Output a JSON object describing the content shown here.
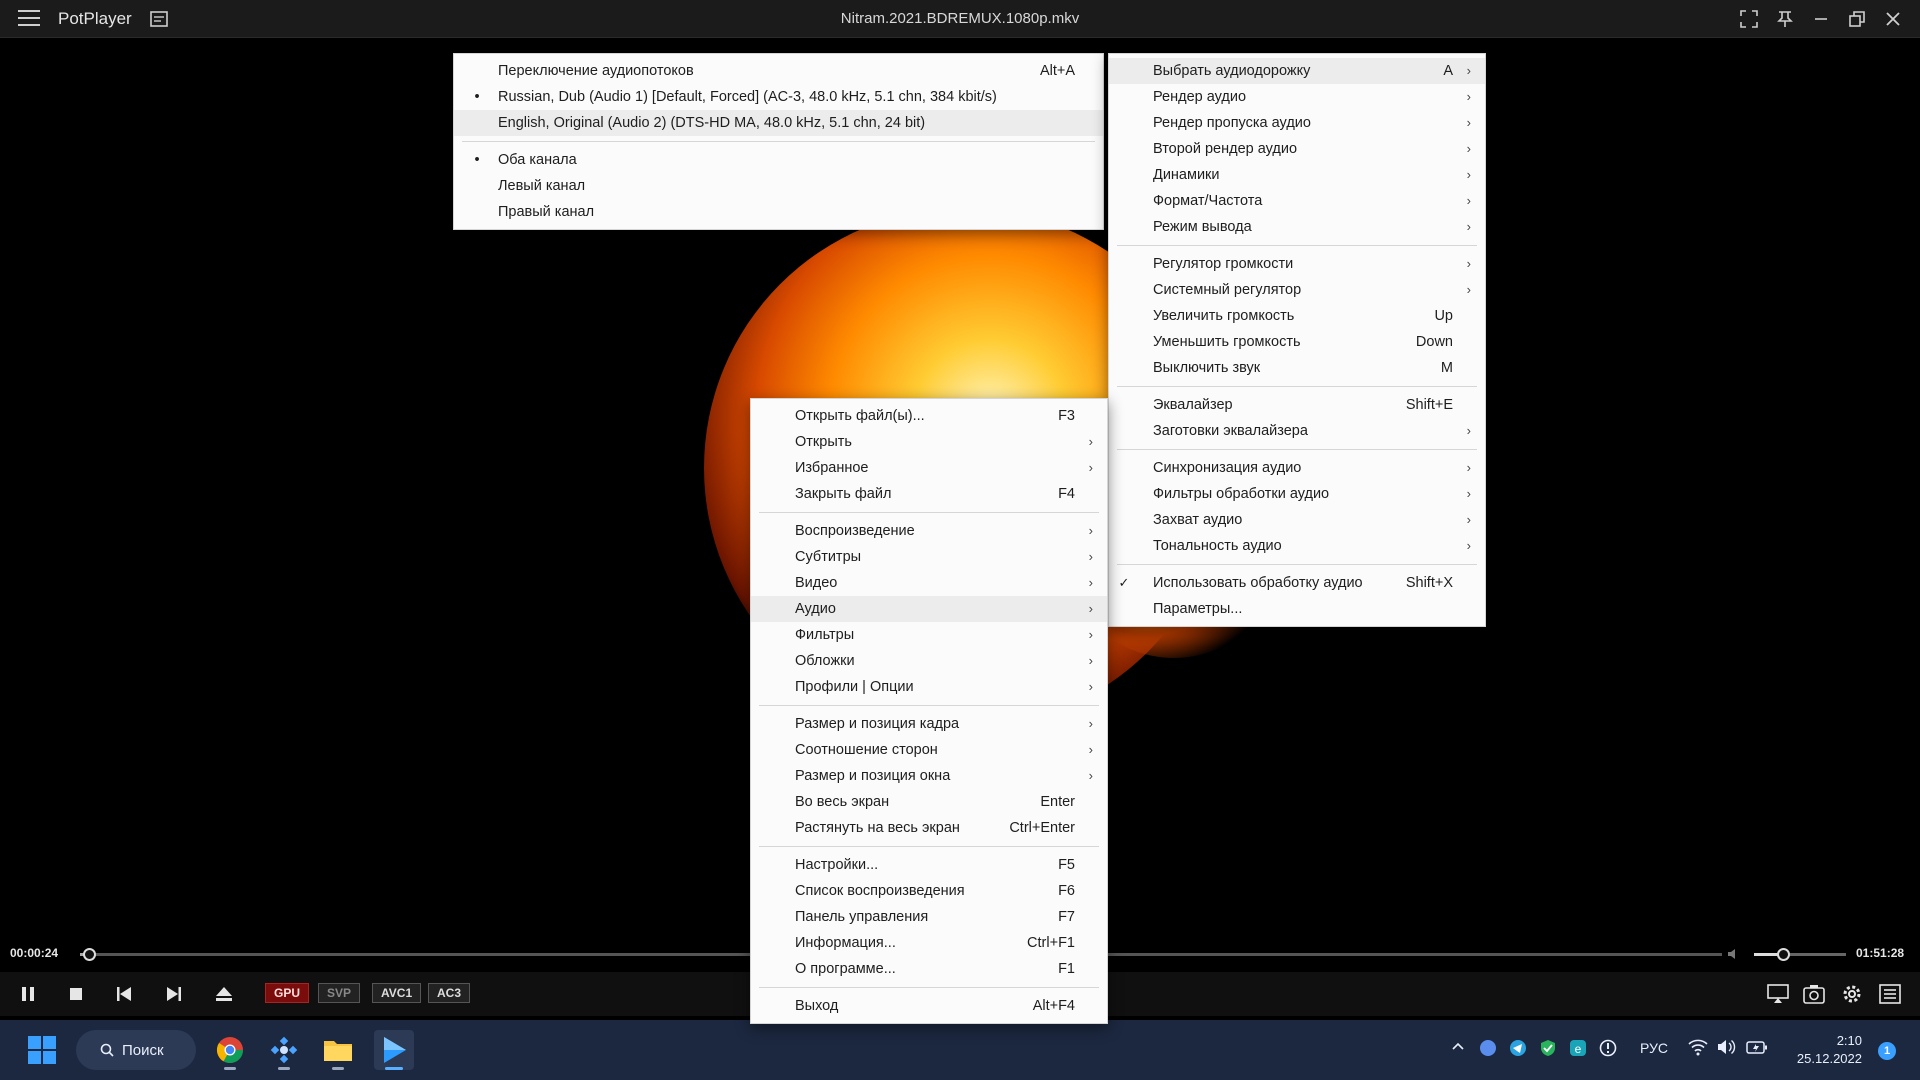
{
  "title_bar": {
    "app_name": "PotPlayer",
    "file_title": "Nitram.2021.BDREMUX.1080p.mkv",
    "icons": [
      "menu-icon",
      "skin-icon",
      "fullscreen-icon",
      "pin-icon",
      "minimize-icon",
      "restore-icon",
      "close-icon"
    ]
  },
  "playback": {
    "current_time": "00:00:24",
    "total_time": "01:51:28",
    "progress_fraction": 0.004,
    "volume_fraction": 0.32
  },
  "controls": {
    "tags": [
      "GPU",
      "SVP",
      "AVC1",
      "AC3"
    ],
    "gpu_color": "#7a0c0c"
  },
  "main_menu": {
    "groups": [
      [
        {
          "label": "Открыть файл(ы)...",
          "shortcut": "F3"
        },
        {
          "label": "Открыть",
          "submenu": true
        },
        {
          "label": "Избранное",
          "submenu": true
        },
        {
          "label": "Закрыть файл",
          "shortcut": "F4"
        }
      ],
      [
        {
          "label": "Воспроизведение",
          "submenu": true
        },
        {
          "label": "Субтитры",
          "submenu": true
        },
        {
          "label": "Видео",
          "submenu": true
        },
        {
          "label": "Аудио",
          "submenu": true,
          "highlighted": true
        },
        {
          "label": "Фильтры",
          "submenu": true
        },
        {
          "label": "Обложки",
          "submenu": true
        },
        {
          "label": "Профили | Опции",
          "submenu": true
        }
      ],
      [
        {
          "label": "Размер и позиция кадра",
          "submenu": true
        },
        {
          "label": "Соотношение сторон",
          "submenu": true
        },
        {
          "label": "Размер и позиция окна",
          "submenu": true
        },
        {
          "label": "Во весь экран",
          "shortcut": "Enter"
        },
        {
          "label": "Растянуть на весь экран",
          "shortcut": "Ctrl+Enter"
        }
      ],
      [
        {
          "label": "Настройки...",
          "shortcut": "F5"
        },
        {
          "label": "Список воспроизведения",
          "shortcut": "F6"
        },
        {
          "label": "Панель управления",
          "shortcut": "F7"
        },
        {
          "label": "Информация...",
          "shortcut": "Ctrl+F1"
        },
        {
          "label": "О программе...",
          "shortcut": "F1"
        }
      ],
      [
        {
          "label": "Выход",
          "shortcut": "Alt+F4"
        }
      ]
    ]
  },
  "audio_menu": {
    "groups": [
      [
        {
          "label": "Выбрать аудиодорожку",
          "shortcut": "A",
          "submenu": true,
          "highlighted": true
        },
        {
          "label": "Рендер аудио",
          "submenu": true
        },
        {
          "label": "Рендер пропуска аудио",
          "submenu": true
        },
        {
          "label": "Второй рендер аудио",
          "submenu": true
        },
        {
          "label": "Динамики",
          "submenu": true
        },
        {
          "label": "Формат/Частота",
          "submenu": true
        },
        {
          "label": "Режим вывода",
          "submenu": true
        }
      ],
      [
        {
          "label": "Регулятор громкости",
          "submenu": true
        },
        {
          "label": "Системный регулятор",
          "submenu": true
        },
        {
          "label": "Увеличить громкость",
          "shortcut": "Up"
        },
        {
          "label": "Уменьшить громкость",
          "shortcut": "Down"
        },
        {
          "label": "Выключить звук",
          "shortcut": "M"
        }
      ],
      [
        {
          "label": "Эквалайзер",
          "shortcut": "Shift+E"
        },
        {
          "label": "Заготовки эквалайзера",
          "submenu": true
        }
      ],
      [
        {
          "label": "Синхронизация аудио",
          "submenu": true
        },
        {
          "label": "Фильтры обработки аудио",
          "submenu": true
        },
        {
          "label": "Захват аудио",
          "submenu": true
        },
        {
          "label": "Тональность аудио",
          "submenu": true
        }
      ],
      [
        {
          "label": "Использовать обработку аудио",
          "shortcut": "Shift+X",
          "checked": true
        },
        {
          "label": "Параметры..."
        }
      ]
    ]
  },
  "streams_menu": {
    "groups": [
      [
        {
          "label": "Переключение аудиопотоков",
          "shortcut": "Alt+A"
        },
        {
          "label": "Russian, Dub (Audio 1) [Default, Forced] (AC-3, 48.0 kHz, 5.1 chn, 384 kbit/s)",
          "bullet": true
        },
        {
          "label": "English, Original (Audio 2) (DTS-HD MA, 48.0 kHz, 5.1 chn, 24 bit)",
          "highlighted": true
        }
      ],
      [
        {
          "label": "Оба канала",
          "bullet": true
        },
        {
          "label": "Левый канал"
        },
        {
          "label": "Правый канал"
        }
      ]
    ]
  },
  "taskbar": {
    "search_label": "Поиск",
    "apps": [
      "chrome-icon",
      "settings-app-icon",
      "file-explorer-icon",
      "potplayer-icon"
    ],
    "language": "РУС",
    "time": "2:10",
    "date": "25.12.2022",
    "notification_count": "1"
  }
}
